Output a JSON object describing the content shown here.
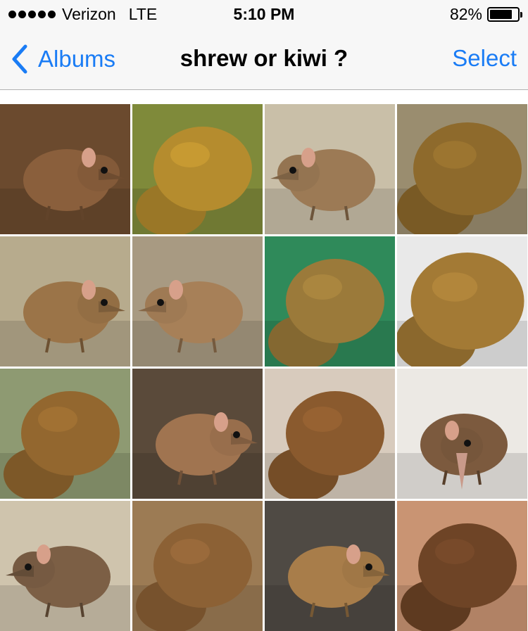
{
  "status": {
    "carrier": "Verizon",
    "network": "LTE",
    "time": "5:10 PM",
    "battery_text": "82%",
    "battery_level": 0.82,
    "signal_bars": 5
  },
  "nav": {
    "back_label": "Albums",
    "title": "shrew or kiwi ?",
    "select_label": "Select"
  },
  "photos": [
    {
      "subject": "shrew",
      "bg": "#6b4a2e",
      "body": "#8a5f3c",
      "facing": "right",
      "scale": 1.05
    },
    {
      "subject": "kiwi",
      "bg": "#7f8a3a",
      "body": "#b58c2e",
      "facing": "none",
      "scale": 1.0
    },
    {
      "subject": "shrew",
      "bg": "#c9bfa8",
      "body": "#9c7a55",
      "facing": "left",
      "scale": 1.0
    },
    {
      "subject": "kiwi",
      "bg": "#9a8d6f",
      "body": "#8e6a2c",
      "facing": "none",
      "scale": 1.1
    },
    {
      "subject": "shrew",
      "bg": "#b7ab8d",
      "body": "#9b7448",
      "facing": "right",
      "scale": 1.0
    },
    {
      "subject": "shrew",
      "bg": "#a89a82",
      "body": "#a78058",
      "facing": "left",
      "scale": 1.0
    },
    {
      "subject": "kiwi",
      "bg": "#2f8a5a",
      "body": "#9b7a3a",
      "facing": "none",
      "scale": 1.0
    },
    {
      "subject": "kiwi",
      "bg": "#e9e9e9",
      "body": "#a37a35",
      "facing": "none",
      "scale": 1.15
    },
    {
      "subject": "kiwi",
      "bg": "#8e9a72",
      "body": "#93672f",
      "facing": "none",
      "scale": 1.0
    },
    {
      "subject": "shrew",
      "bg": "#5a4a3a",
      "body": "#a07450",
      "facing": "right",
      "scale": 1.0
    },
    {
      "subject": "kiwi",
      "bg": "#d8cbbd",
      "body": "#8a5a2e",
      "facing": "none",
      "scale": 1.0
    },
    {
      "subject": "shrew",
      "bg": "#ece9e4",
      "body": "#7c5a3e",
      "facing": "down",
      "scale": 1.0
    },
    {
      "subject": "shrew",
      "bg": "#cfc4ad",
      "body": "#7c5f45",
      "facing": "left",
      "scale": 1.0
    },
    {
      "subject": "kiwi",
      "bg": "#9c7b54",
      "body": "#8c6135",
      "facing": "none",
      "scale": 1.0
    },
    {
      "subject": "shrew",
      "bg": "#4f4a44",
      "body": "#a87d4a",
      "facing": "right",
      "scale": 1.0
    },
    {
      "subject": "kiwi",
      "bg": "#c99473",
      "body": "#6e4426",
      "facing": "none",
      "scale": 1.0
    }
  ]
}
